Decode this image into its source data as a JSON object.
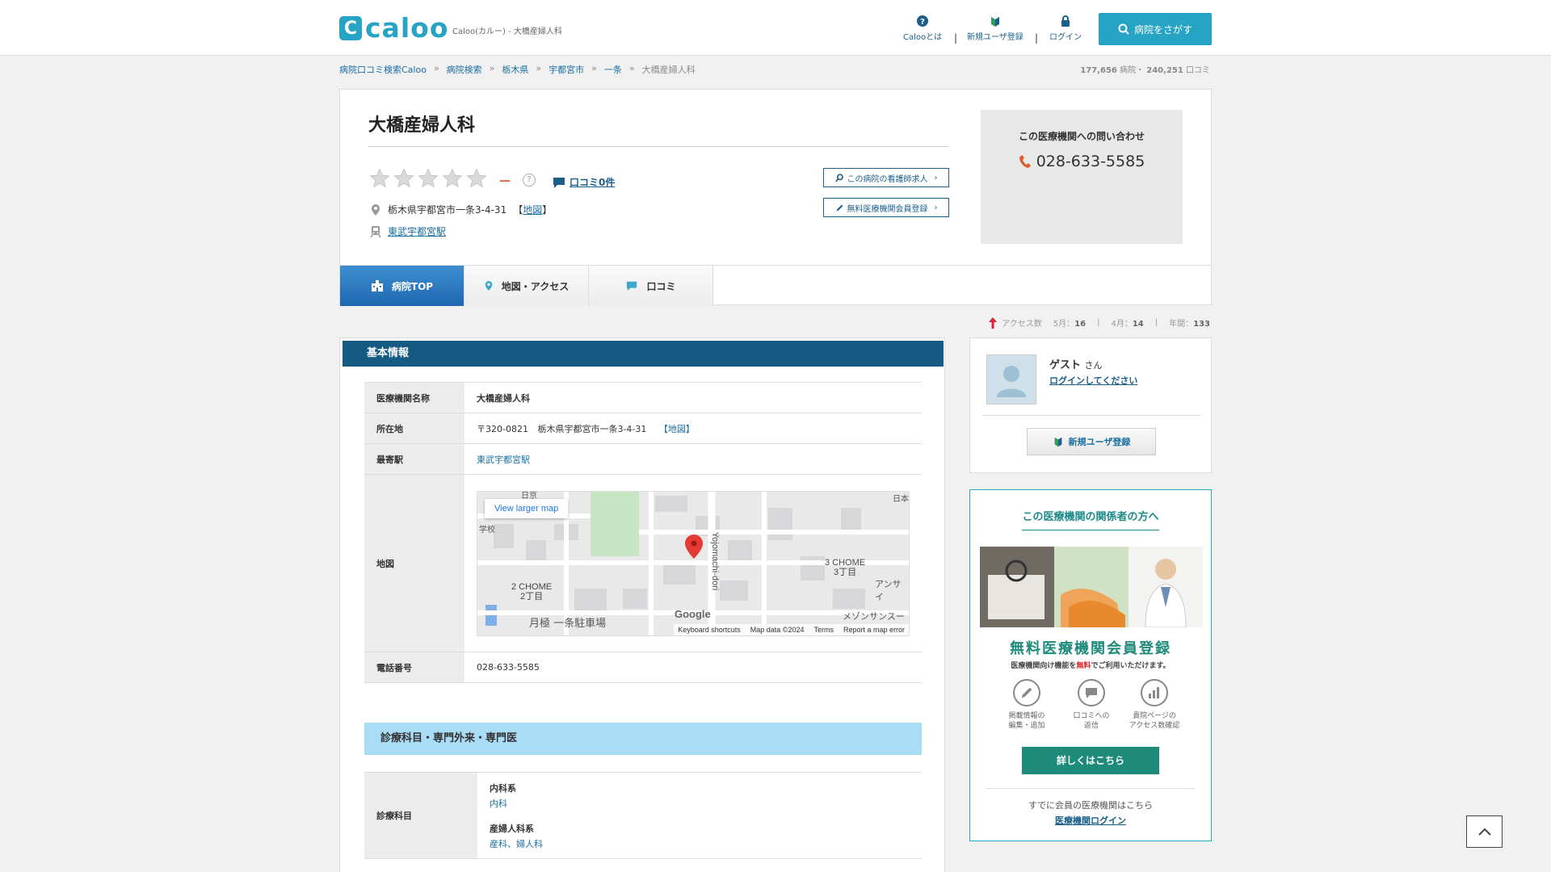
{
  "header": {
    "logo_text": "caloo",
    "logo_mark": "C",
    "site_tag": "Caloo(カルー) - 大橋産婦人科",
    "nav": [
      {
        "label": "Calooとは",
        "icon": "question-icon"
      },
      {
        "label": "新規ユーザ登録",
        "icon": "beginner-mark-icon"
      },
      {
        "label": "ログイン",
        "icon": "lock-icon"
      }
    ],
    "nav_sep": "|",
    "search_button": "病院をさがす"
  },
  "breadcrumb": [
    "病院口コミ検索Caloo",
    "病院検索",
    "栃木県",
    "宇都宮市",
    "一条",
    "大橋産婦人科"
  ],
  "breadcrumb_sep": "»",
  "counts": {
    "hospitals": "177,656",
    "hospitals_unit": "病院・",
    "reviews": "240,251",
    "reviews_unit": "口コミ"
  },
  "hospital": {
    "name": "大橋産婦人科",
    "rating": 0,
    "rating_dash": "－",
    "help": "?",
    "reviews_link": "口コミ0件",
    "address": "栃木県宇都宮市一条3-4-31",
    "map_bracket_open": "【",
    "map_link": "地図",
    "map_bracket_close": "】",
    "station": "東武宇都宮駅",
    "nurse_button": "この病院の看護師求人",
    "member_button": "無料医療機関会員登録",
    "contact_title": "この医療機関への問い合わせ",
    "phone": "028-633-5585"
  },
  "tabs": [
    {
      "label": "病院TOP",
      "icon": "hospital-icon"
    },
    {
      "label": "地図・アクセス",
      "icon": "map-pin-icon"
    },
    {
      "label": "口コミ",
      "icon": "speech-bubble-icon"
    }
  ],
  "access": {
    "label": "アクセス数",
    "may_label": "5月：",
    "may": "16",
    "apr_label": "4月：",
    "apr": "14",
    "year_label": "年間：",
    "year": "133",
    "sep": "|"
  },
  "basic": {
    "heading": "基本情報",
    "rows": {
      "name_label": "医療機関名称",
      "name_value": "大橋産婦人科",
      "address_label": "所在地",
      "postal": "〒320-0821",
      "address_value": "栃木県宇都宮市一条3-4-31",
      "map_link": "【地図】",
      "station_label": "最寄駅",
      "station_value": "東武宇都宮駅",
      "map_label": "地図",
      "phone_label": "電話番号",
      "phone_value": "028-633-5585"
    },
    "map": {
      "larger_map": "View larger map",
      "label_2chome_en": "2 CHOME",
      "label_2chome_jp": "2丁目",
      "label_3chome_en": "3 CHOME",
      "label_3chome_jp": "3丁目",
      "road": "Yojomachi-dori",
      "parking": "月極 一条駐車場",
      "ansai": "アンサイ",
      "maison": "メゾンサンスー",
      "school_a": "学校",
      "top_left": "日京",
      "top_right": "日本",
      "google": "Google",
      "shortcuts": "Keyboard shortcuts",
      "map_data": "Map data ©2024",
      "terms": "Terms",
      "report": "Report a map error"
    }
  },
  "departments": {
    "heading": "診療科目・専門外来・専門医",
    "row_label": "診療科目",
    "groups": [
      {
        "group": "内科系",
        "items": "内科"
      },
      {
        "group": "産婦人科系",
        "items": "産科、婦人科"
      }
    ]
  },
  "user": {
    "name": "ゲスト",
    "suffix": "さん",
    "login_prompt": "ログインしてください",
    "register_button": "新規ユーザ登録"
  },
  "related": {
    "title": "この医療機関の関係者の方へ",
    "free_title": "無料医療機関会員登録",
    "free_sub_a": "医療機関向け機能を",
    "free_sub_em": "無料",
    "free_sub_b": "でご利用いただけます。",
    "features": [
      {
        "line1": "掲載情報の",
        "line2": "編集・追加",
        "icon": "pencil-icon"
      },
      {
        "line1": "口コミへの",
        "line2": "返信",
        "icon": "chat-icon"
      },
      {
        "line1": "貴院ページの",
        "line2": "アクセス数確認",
        "icon": "bar-chart-icon"
      }
    ],
    "detail_button": "詳しくはこちら",
    "already_member": "すでに会員の医療機関はこちら",
    "login_link": "医療機関ログイン"
  },
  "colors": {
    "brand": "#27a4c4",
    "heading_bar": "#145a82",
    "tab_active": "#2a77bd",
    "section_light": "#a9dcf5",
    "teal": "#1d8a7a",
    "rating_dash": "#e05a2b"
  }
}
